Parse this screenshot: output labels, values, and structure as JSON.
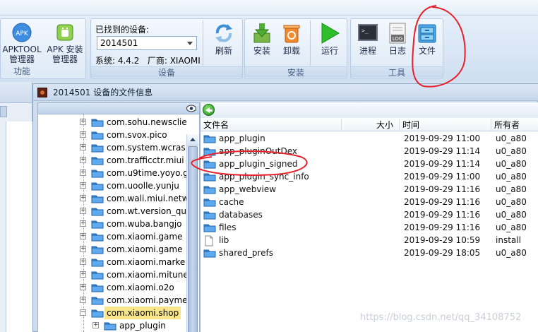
{
  "ribbon": {
    "groups": {
      "func_label": "功能",
      "device_label": "设备",
      "install_label": "安装",
      "tools_label": "工具"
    },
    "apktool": {
      "line1": "APKTOOL",
      "line2": "管理器"
    },
    "apk_install": {
      "line1": "APK 安装",
      "line2": "管理器"
    },
    "device": {
      "found_label": "已找到的设备:",
      "selected": "2014501",
      "system_info": "系统: 4.4.2   厂商: XIAOMI",
      "refresh_label": "刷新"
    },
    "install_btn": "安装",
    "uninstall_btn": "卸载",
    "run_btn": "运行",
    "process_btn": "进程",
    "log_btn": "日志",
    "file_btn": "文件",
    "log_icon_text": "LOG"
  },
  "dialog": {
    "title": "2014501 设备的文件信息"
  },
  "tree": {
    "items": [
      {
        "label": "com.sohu.newsclie",
        "expander": "+"
      },
      {
        "label": "com.svox.pico",
        "expander": "+"
      },
      {
        "label": "com.system.wcras",
        "expander": "+"
      },
      {
        "label": "com.trafficctr.miui",
        "expander": "+"
      },
      {
        "label": "com.u9time.yoyo.g",
        "expander": "+"
      },
      {
        "label": "com.uoolle.yunju",
        "expander": "+"
      },
      {
        "label": "com.wali.miui.netw",
        "expander": "+"
      },
      {
        "label": "com.wt.version_qu",
        "expander": "+"
      },
      {
        "label": "com.wuba.bangjo",
        "expander": "+"
      },
      {
        "label": "com.xiaomi.game",
        "expander": "+"
      },
      {
        "label": "com.xiaomi.game",
        "expander": "+"
      },
      {
        "label": "com.xiaomi.marke",
        "expander": "+"
      },
      {
        "label": "com.xiaomi.mitune",
        "expander": "+"
      },
      {
        "label": "com.xiaomi.o2o",
        "expander": "+"
      },
      {
        "label": "com.xiaomi.payme",
        "expander": "+"
      },
      {
        "label": "com.xiaomi.shop",
        "expander": "−"
      },
      {
        "label": "app_plugin",
        "expander": "+"
      }
    ]
  },
  "files": {
    "columns": {
      "name": "文件名",
      "size": "大小",
      "time": "时间",
      "owner": "所有者"
    },
    "rows": [
      {
        "name": "app_plugin",
        "time": "2019-09-29 11:00",
        "owner": "u0_a80",
        "type": "folder"
      },
      {
        "name": "app_pluginOutDex",
        "time": "2019-09-29 11:14",
        "owner": "u0_a80",
        "type": "folder"
      },
      {
        "name": "app_plugin_signed",
        "time": "2019-09-29 11:14",
        "owner": "u0_a80",
        "type": "folder"
      },
      {
        "name": "app_plugin_sync_info",
        "time": "2019-09-29 11:00",
        "owner": "u0_a80",
        "type": "folder"
      },
      {
        "name": "app_webview",
        "time": "2019-09-29 11:16",
        "owner": "u0_a80",
        "type": "folder"
      },
      {
        "name": "cache",
        "time": "2019-09-29 11:16",
        "owner": "u0_a80",
        "type": "folder"
      },
      {
        "name": "databases",
        "time": "2019-09-29 11:16",
        "owner": "u0_a80",
        "type": "folder"
      },
      {
        "name": "files",
        "time": "2019-09-29 11:16",
        "owner": "u0_a80",
        "type": "folder"
      },
      {
        "name": "lib",
        "time": "2019-09-29 10:59",
        "owner": "install",
        "type": "file"
      },
      {
        "name": "shared_prefs",
        "time": "2019-09-29 18:05",
        "owner": "u0_a80",
        "type": "folder"
      }
    ]
  },
  "watermark": "https://blog.csdn.net/qq_34108752",
  "colors": {
    "annotation_red": "#e8202a",
    "folder_blue": "#3d8fd9",
    "selection": "#f8e58c"
  }
}
